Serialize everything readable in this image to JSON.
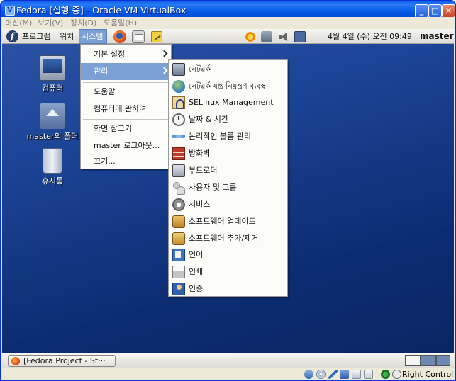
{
  "window": {
    "title": "Fedora [실행 중] - Oracle VM VirtualBox",
    "app_icon": "virtualbox-icon",
    "buttons": {
      "minimize": "_",
      "maximize": "□",
      "close": "✕"
    }
  },
  "vb_menu": [
    "머신(M)",
    "보기(V)",
    "장치(D)",
    "도움말(H)"
  ],
  "top_panel": {
    "applications": "프로그램",
    "places": "위치",
    "system": "시스템",
    "clock": "4월  4일 (수) 오전 09:49",
    "user": "master"
  },
  "desktop_icons": [
    {
      "label": "컴퓨터",
      "icon": "computer-icon"
    },
    {
      "label": "master의 폴더",
      "icon": "home-folder-icon"
    },
    {
      "label": "휴지통",
      "icon": "trash-icon"
    }
  ],
  "system_menu": {
    "items": [
      {
        "label": "기본 설정",
        "has_submenu": true
      },
      {
        "label": "관리",
        "has_submenu": true,
        "active": true
      },
      {
        "label": "도움말",
        "has_submenu": false
      },
      {
        "label": "컴퓨터에 관하여",
        "has_submenu": false
      },
      {
        "label": "화면 잠그기",
        "has_submenu": false
      },
      {
        "label": "master 로그아웃...",
        "has_submenu": false
      },
      {
        "label": "끄기...",
        "has_submenu": false
      }
    ]
  },
  "admin_menu": {
    "items": [
      {
        "label": "নেটৱর্ক",
        "icon": "network-icon"
      },
      {
        "label": "নেটৱর্ক যন্ত্র নিয়ন্ত্রণ ব্যবস্থা",
        "icon": "network-device-icon"
      },
      {
        "label": "SELinux Management",
        "icon": "selinux-icon"
      },
      {
        "label": "날짜 & 시간",
        "icon": "clock-icon"
      },
      {
        "label": "논리적인 볼륨 관리",
        "icon": "lvm-icon"
      },
      {
        "label": "방화벽",
        "icon": "firewall-icon"
      },
      {
        "label": "부트로더",
        "icon": "bootloader-icon"
      },
      {
        "label": "사용자 및 그룹",
        "icon": "users-icon"
      },
      {
        "label": "서비스",
        "icon": "services-icon"
      },
      {
        "label": "소프트웨어 업데이트",
        "icon": "software-update-icon"
      },
      {
        "label": "소프트웨어 추가/제거",
        "icon": "add-remove-software-icon"
      },
      {
        "label": "언어",
        "icon": "language-icon"
      },
      {
        "label": "인쇄",
        "icon": "printer-icon"
      },
      {
        "label": "인증",
        "icon": "authentication-icon"
      }
    ]
  },
  "bottom_panel": {
    "taskbar_window": "[Fedora Project - St···"
  },
  "statusbar": {
    "host_key": "Right Control"
  },
  "colors": {
    "xp_title": "#0558e4",
    "menu_highlight": "#7aa0d6",
    "desktop": "#1c4496"
  }
}
